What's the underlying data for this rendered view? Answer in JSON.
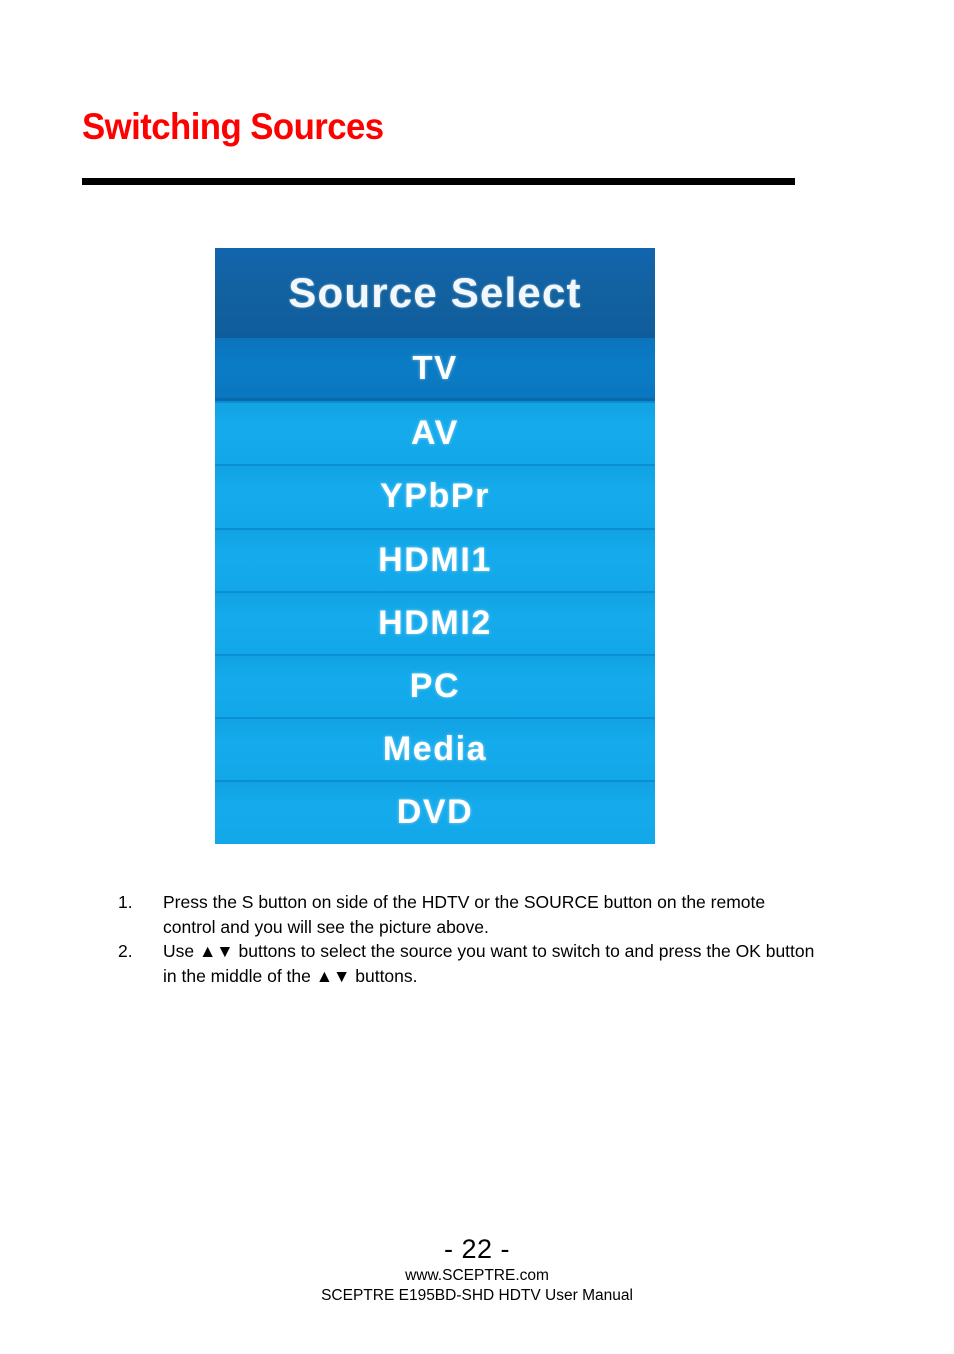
{
  "page": {
    "title": "Switching Sources",
    "title_color": "#FF0000",
    "rule_color": "#000000"
  },
  "osd": {
    "header": "Source Select",
    "header_bg": "#12619F",
    "row_bg": "#12A7E8",
    "selected_bg": "#0A7CC6",
    "separator_color": "#0C8ED2",
    "text_color": "#FFFFFF",
    "selected_index": 0,
    "rows": [
      {
        "label": "TV",
        "selected": true
      },
      {
        "label": "AV",
        "selected": false
      },
      {
        "label": "YPbPr",
        "selected": false
      },
      {
        "label": "HDMI1",
        "selected": false
      },
      {
        "label": "HDMI2",
        "selected": false
      },
      {
        "label": "PC",
        "selected": false
      },
      {
        "label": "Media",
        "selected": false
      },
      {
        "label": "DVD",
        "selected": false
      }
    ]
  },
  "instructions": [
    {
      "number": "1.",
      "text": "Press the S button on side of the HDTV or the SOURCE button on the remote control and you will see the picture above."
    },
    {
      "number": "2.",
      "text": "Use ▲▼ buttons to select the source you want to switch to and press the OK button in the middle of the ▲▼ buttons."
    }
  ],
  "footer": {
    "page_number": "- 22 -",
    "website": "www.SCEPTRE.com",
    "manual": "SCEPTRE E195BD-SHD HDTV User Manual"
  }
}
